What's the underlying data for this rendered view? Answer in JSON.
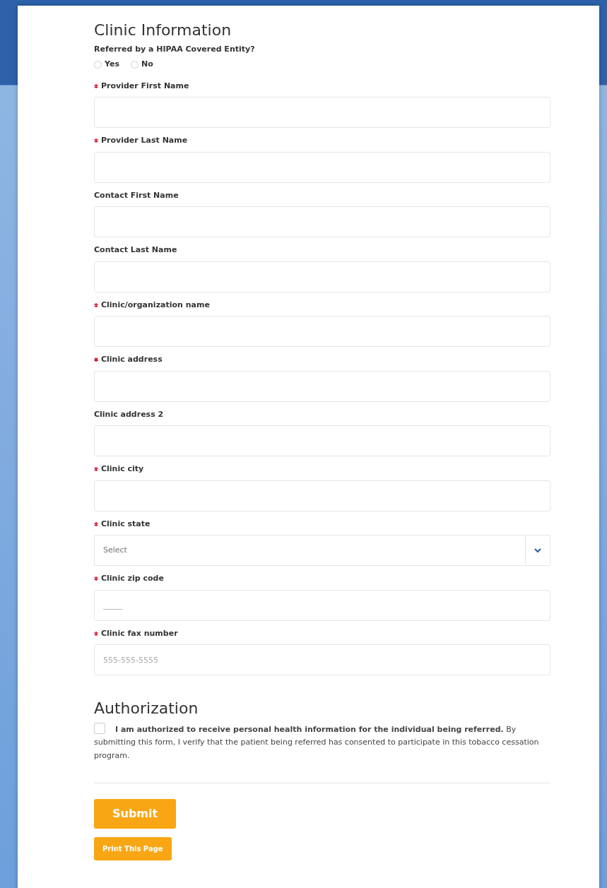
{
  "clinic_section": {
    "title": "Clinic Information",
    "hipaa_question": {
      "label": "Referred by a HIPAA Covered Entity?",
      "options": [
        {
          "label": "Yes",
          "selected": false
        },
        {
          "label": "No",
          "selected": false
        }
      ]
    },
    "fields": [
      {
        "kind": "text",
        "label": "Provider First Name",
        "required": true
      },
      {
        "kind": "text",
        "label": "Provider Last Name",
        "required": true
      },
      {
        "kind": "text",
        "label": "Contact First Name",
        "required": false
      },
      {
        "kind": "text",
        "label": "Contact Last Name",
        "required": false
      },
      {
        "kind": "text",
        "label": "Clinic/organization name",
        "required": true
      },
      {
        "kind": "text",
        "label": "Clinic address",
        "required": true
      },
      {
        "kind": "text",
        "label": "Clinic address 2",
        "required": false
      },
      {
        "kind": "text",
        "label": "Clinic city",
        "required": true
      },
      {
        "kind": "select",
        "label": "Clinic state",
        "required": true,
        "placeholder": "Select"
      },
      {
        "kind": "text",
        "label": "Clinic zip code",
        "required": true,
        "placeholder": "_____"
      },
      {
        "kind": "text",
        "label": "Clinic fax number",
        "required": true,
        "placeholder": "555-555-5555"
      }
    ]
  },
  "authorization": {
    "title": "Authorization",
    "checked": false,
    "text": "**I am authorized to receive personal health information for the individual being referred.** By submitting this form, I verify that the patient being referred has consented to participate in this tobacco cessation program."
  },
  "buttons": [
    {
      "kind": "primary",
      "label": "Submit"
    },
    {
      "kind": "small",
      "label": "Print This Page"
    }
  ]
}
